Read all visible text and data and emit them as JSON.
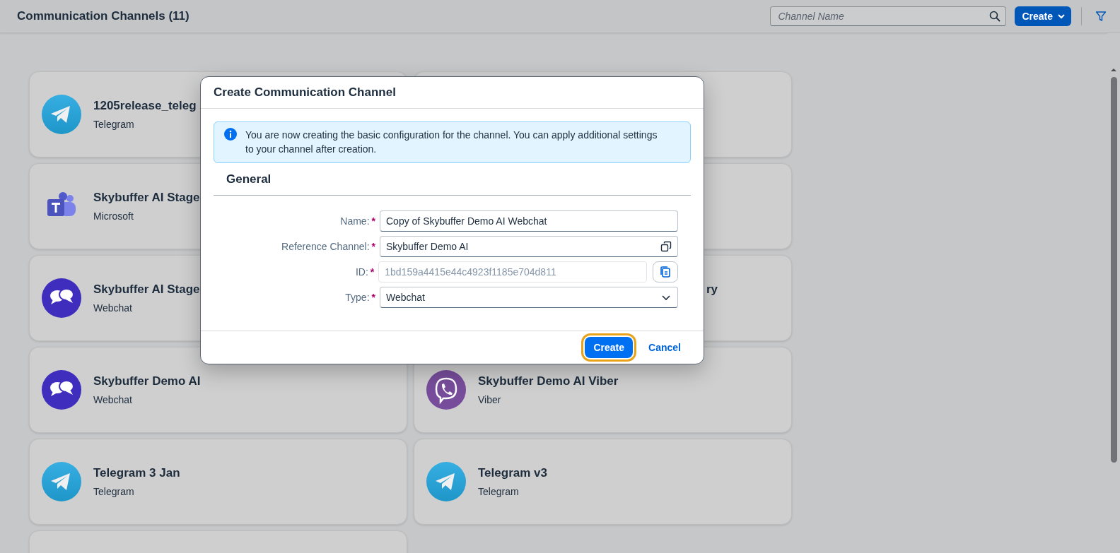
{
  "header": {
    "title": "Communication Channels (11)",
    "search": {
      "placeholder": "Channel Name"
    },
    "create_button": "Create"
  },
  "cards": [
    {
      "kind": "telegram",
      "title": "1205release_teleg",
      "subtitle": "Telegram"
    },
    {
      "kind": "covered"
    },
    {
      "kind": "teams",
      "title": "Skybuffer AI Stage",
      "subtitle": "Microsoft"
    },
    {
      "kind": "covered"
    },
    {
      "kind": "webchat",
      "title": "Skybuffer AI Stage",
      "subtitle": "Webchat"
    },
    {
      "kind": "covered",
      "title": "ry"
    },
    {
      "kind": "webchat",
      "title": "Skybuffer Demo AI",
      "subtitle": "Webchat"
    },
    {
      "kind": "viber",
      "title": "Skybuffer Demo AI Viber",
      "subtitle": "Viber"
    },
    {
      "kind": "telegram",
      "title": "Telegram 3 Jan",
      "subtitle": "Telegram"
    },
    {
      "kind": "telegram",
      "title": "Telegram v3",
      "subtitle": "Telegram"
    },
    {
      "kind": "covered"
    }
  ],
  "dialog": {
    "title": "Create Communication Channel",
    "info": "You are now creating the basic configuration for the channel. You can apply additional settings to your channel after creation.",
    "section": "General",
    "fields": [
      {
        "kind": "text",
        "label": "Name:",
        "required_mark": "*",
        "value": "Copy of Skybuffer Demo AI Webchat",
        "disabled": false
      },
      {
        "kind": "value-help",
        "label": "Reference Channel:",
        "required_mark": "*",
        "value": "Skybuffer Demo AI",
        "disabled": false
      },
      {
        "kind": "copy",
        "label": "ID:",
        "required_mark": "*",
        "value": "1bd159a4415e44c4923f1185e704d811",
        "disabled": true
      },
      {
        "kind": "select",
        "label": "Type:",
        "required_mark": "*",
        "value": "Webchat",
        "disabled": false
      }
    ],
    "buttons": [
      {
        "kind": "emphasized",
        "label": "Create",
        "focused": true
      },
      {
        "kind": "transparent",
        "label": "Cancel",
        "focused": false
      }
    ]
  }
}
